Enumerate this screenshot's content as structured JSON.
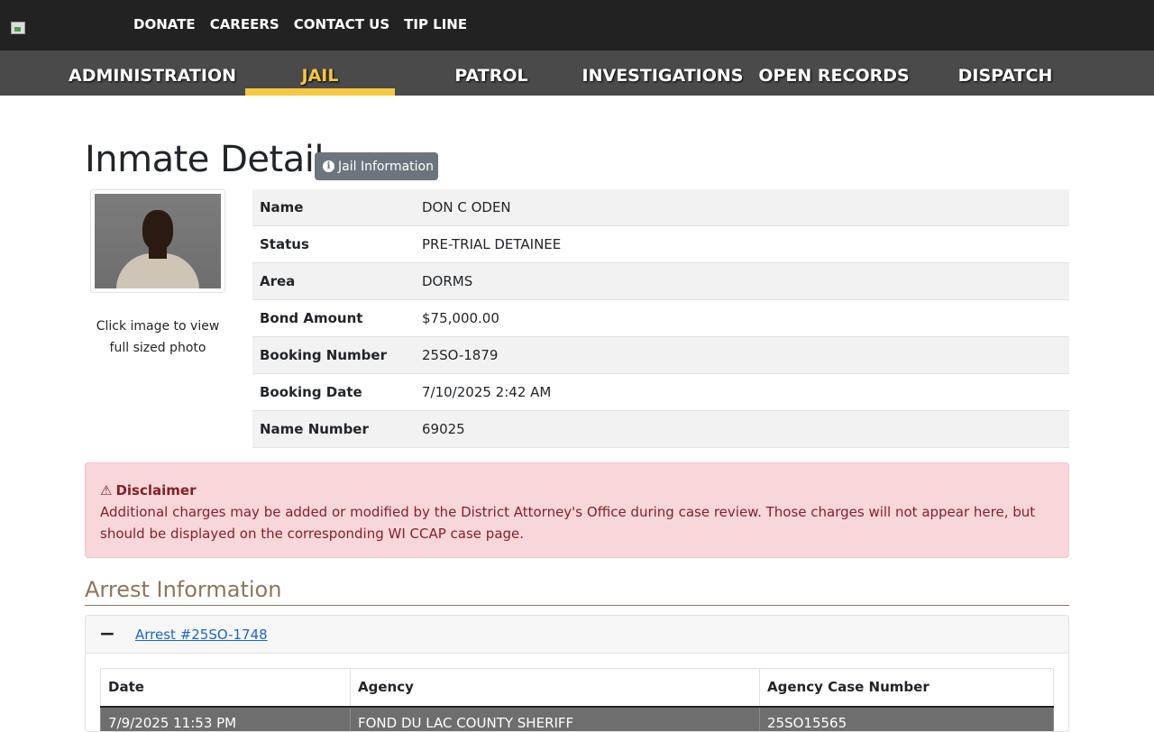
{
  "topbar": {
    "links": [
      "DONATE",
      "CAREERS",
      "CONTACT US",
      "TIP LINE"
    ]
  },
  "nav": {
    "items": [
      "ADMINISTRATION",
      "JAIL",
      "PATROL",
      "INVESTIGATIONS",
      "OPEN RECORDS",
      "DISPATCH"
    ],
    "active": "JAIL",
    "active_color": "#f5c842"
  },
  "page": {
    "title": "Inmate Detail",
    "jail_info_button": "Jail Information",
    "photo_caption": "Click image to view full sized photo"
  },
  "details": [
    {
      "label": "Name",
      "value": "DON C ODEN"
    },
    {
      "label": "Status",
      "value": "PRE-TRIAL DETAINEE"
    },
    {
      "label": "Area",
      "value": "DORMS"
    },
    {
      "label": "Bond Amount",
      "value": "$75,000.00"
    },
    {
      "label": "Booking Number",
      "value": "25SO-1879"
    },
    {
      "label": "Booking Date",
      "value": "7/10/2025 2:42 AM"
    },
    {
      "label": "Name Number",
      "value": "69025"
    }
  ],
  "disclaimer": {
    "title": "Disclaimer",
    "text": "Additional charges may be added or modified by the District Attorney's Office during case review. Those charges will not appear here, but should be displayed on the corresponding WI CCAP case page."
  },
  "arrest_section": {
    "title": "Arrest Information",
    "toggle": "−",
    "arrest_link": "Arrest #25SO-1748",
    "columns": [
      "Date",
      "Agency",
      "Agency Case Number"
    ],
    "rows": [
      [
        "7/9/2025 11:53 PM",
        "FOND DU LAC COUNTY SHERIFF",
        "25SO15565"
      ]
    ]
  }
}
